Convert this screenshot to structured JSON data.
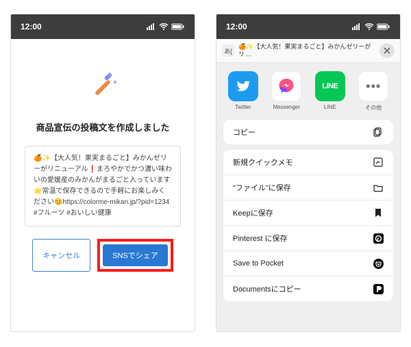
{
  "statusBar": {
    "time": "12:00"
  },
  "left": {
    "title": "商品宣伝の投稿文を作成しました",
    "postText": "🍊✨【大人気！果実まるごと】みかんゼリーがリニューアル❗まろやかでかつ濃い味わいの愛媛産のみかんがまるごと入っています🌟常温で保存できるので手軽にお楽しみください😊https://colorme-mikan.jp/?pid=1234\n#フルーツ #おいしい健康",
    "cancelLabel": "キャンセル",
    "shareLabel": "SNSでシェア"
  },
  "right": {
    "urlPrefix": "あ[",
    "urlText": "🍊✨【大人気！果実まるごと】みかんゼリーがリ ...",
    "apps": [
      {
        "name": "Twitter",
        "bg": "#1d9bf0",
        "label": "Twitter"
      },
      {
        "name": "Messenger",
        "bg": "#ffffff",
        "label": "Messenger"
      },
      {
        "name": "LINE",
        "bg": "#06c755",
        "label": "LINE"
      },
      {
        "name": "Other",
        "bg": "#ffffff",
        "label": "その他"
      }
    ],
    "copyLabel": "コピー",
    "actions": [
      {
        "label": "新規クイックメモ",
        "icon": "quickmemo"
      },
      {
        "label": "\"ファイル\"に保存",
        "icon": "folder"
      },
      {
        "label": "Keepに保存",
        "icon": "bookmark"
      },
      {
        "label": "Pinterest に保存",
        "icon": "pinterest"
      },
      {
        "label": "Save to Pocket",
        "icon": "pocket"
      },
      {
        "label": "Documentsにコピー",
        "icon": "documents"
      }
    ]
  }
}
